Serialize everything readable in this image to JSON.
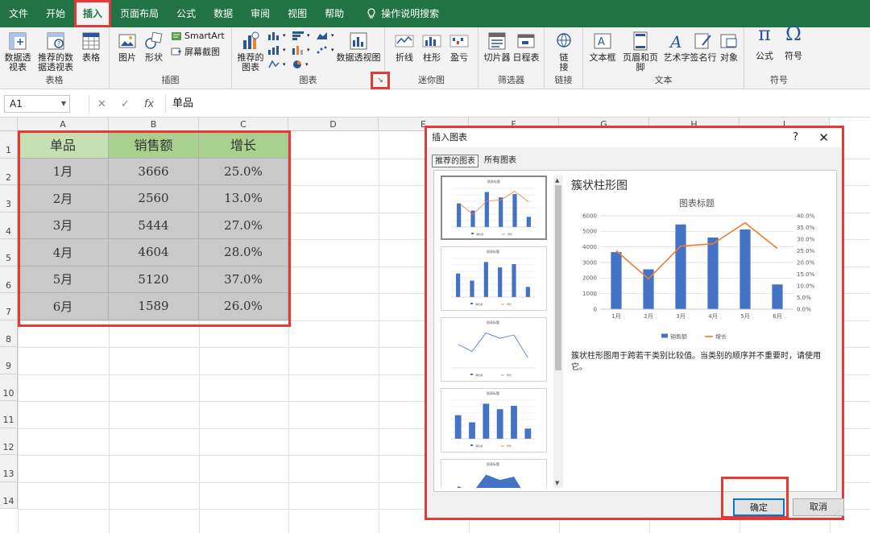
{
  "ribbon": {
    "tabs": [
      "文件",
      "开始",
      "插入",
      "页面布局",
      "公式",
      "数据",
      "审阅",
      "视图",
      "帮助"
    ],
    "active_tab": "插入",
    "search_label": "操作说明搜索",
    "groups": {
      "tables": {
        "label": "表格",
        "pivot": "数据透视表",
        "rec_pivot": "推荐的数据透视表",
        "table": "表格"
      },
      "illustrations": {
        "label": "插图",
        "pictures": "图片",
        "shapes": "形状",
        "smartart": "SmartArt",
        "screenshot": "屏幕截图"
      },
      "charts": {
        "label": "图表",
        "recommended": "推荐的图表",
        "pivot_chart": "数据透视图"
      },
      "sparklines": {
        "label": "迷你图",
        "line": "折线",
        "column": "柱形",
        "winloss": "盈亏"
      },
      "filters": {
        "label": "筛选器",
        "slicer": "切片器",
        "timeline": "日程表"
      },
      "links": {
        "label": "链接",
        "link": "链接"
      },
      "text": {
        "label": "文本",
        "textbox": "文本框",
        "header_footer": "页眉和页脚",
        "wordart": "艺术字",
        "signature": "签名行",
        "object": "对象"
      },
      "symbols": {
        "label": "符号",
        "equation": "公式",
        "symbol": "符号"
      }
    }
  },
  "formula_bar": {
    "name_box": "A1",
    "content": "单品"
  },
  "sheet": {
    "columns": [
      "A",
      "B",
      "C",
      "D",
      "E",
      "F",
      "G",
      "H",
      "I"
    ],
    "rows": [
      "1",
      "2",
      "3",
      "4",
      "5",
      "6",
      "7",
      "8",
      "9",
      "10",
      "11",
      "12",
      "13",
      "14"
    ],
    "headers": [
      "单品",
      "销售额",
      "增长"
    ],
    "data": [
      [
        "1月",
        "3666",
        "25.0%"
      ],
      [
        "2月",
        "2560",
        "13.0%"
      ],
      [
        "3月",
        "5444",
        "27.0%"
      ],
      [
        "4月",
        "4604",
        "28.0%"
      ],
      [
        "5月",
        "5120",
        "37.0%"
      ],
      [
        "6月",
        "1589",
        "26.0%"
      ]
    ]
  },
  "dialog": {
    "title": "插入图表",
    "help": "?",
    "tabs": [
      "推荐的图表",
      "所有图表"
    ],
    "chart_type_name": "簇状柱形图",
    "description": "簇状柱形图用于跨若干类别比较值。当类别的顺序并不重要时，请使用它。",
    "ok": "确定",
    "cancel": "取消"
  },
  "chart_data": {
    "type": "bar",
    "title": "图表标题",
    "categories": [
      "1月",
      "2月",
      "3月",
      "4月",
      "5月",
      "6月"
    ],
    "series": [
      {
        "name": "销售额",
        "type": "bar",
        "axis": "primary",
        "values": [
          3666,
          2560,
          5444,
          4604,
          5120,
          1589
        ],
        "color": "#4472c4"
      },
      {
        "name": "增长",
        "type": "line",
        "axis": "secondary",
        "values": [
          25.0,
          13.0,
          27.0,
          28.0,
          37.0,
          26.0
        ],
        "color": "#ed7d31"
      }
    ],
    "y_ticks": [
      "0",
      "1000",
      "2000",
      "3000",
      "4000",
      "5000",
      "6000"
    ],
    "y2_ticks": [
      "0.0%",
      "5.0%",
      "10.0%",
      "15.0%",
      "20.0%",
      "25.0%",
      "30.0%",
      "35.0%",
      "40.0%"
    ],
    "ylim": [
      0,
      6000
    ],
    "y2lim": [
      0,
      40
    ],
    "grid": true,
    "legend": "bottom"
  }
}
